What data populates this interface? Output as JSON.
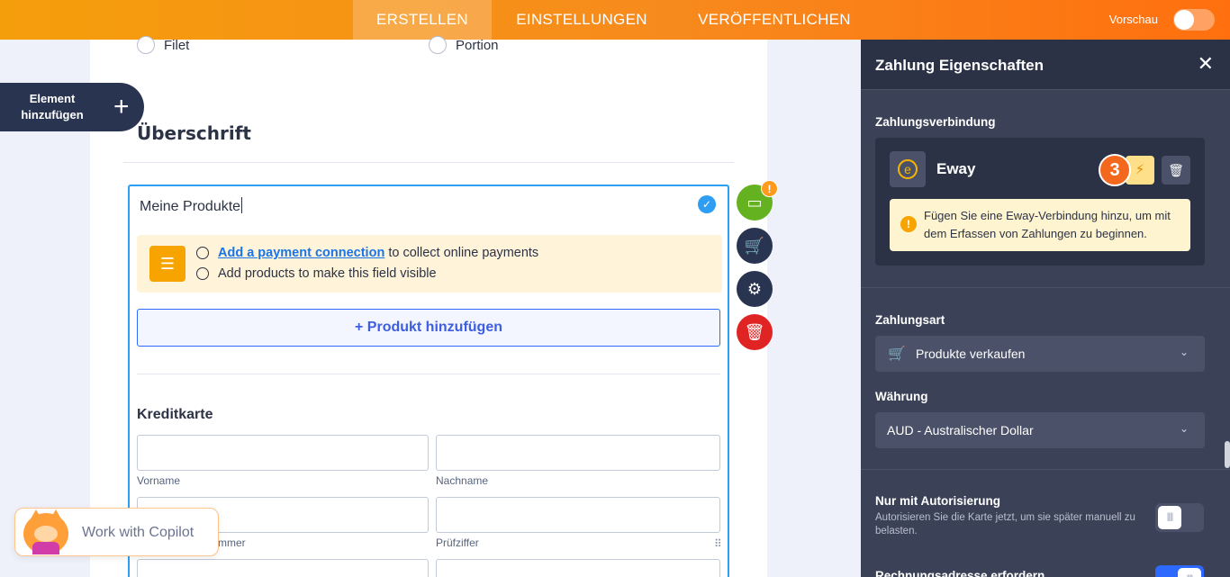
{
  "topbar": {
    "tabs": [
      {
        "label": "ERSTELLEN",
        "active": true
      },
      {
        "label": "EINSTELLUNGEN",
        "active": false
      },
      {
        "label": "VERÖFFENTLICHEN",
        "active": false
      }
    ],
    "preview_label": "Vorschau",
    "preview_on": false
  },
  "sidebar_button": {
    "label": "Element hinzufügen",
    "icon": "plus-icon"
  },
  "form": {
    "radio_options": [
      "Filet",
      "Portion"
    ],
    "heading": "Überschrift",
    "payment_field": {
      "title": "Meine Produkte",
      "notice": {
        "link": "Add a payment connection",
        "line1_rest": " to collect online payments",
        "line2": "Add products to make this field visible"
      },
      "add_product_label": "+ Produkt hinzufügen",
      "credit_card": {
        "heading": "Kreditkarte",
        "first_name": "Vorname",
        "last_name": "Nachname",
        "card_number_partial": "mmer",
        "check_digit": "Prüfziffer"
      }
    },
    "warning_badge": "!"
  },
  "copilot": {
    "label": "Work with Copilot"
  },
  "panel": {
    "title": "Zahlung Eigenschaften",
    "connection_heading": "Zahlungsverbindung",
    "gateway_name": "Eway",
    "step_number": "3",
    "tip_text": "Fügen Sie eine Eway-Verbindung hinzu, um mit dem Erfassen von Zahlungen zu beginnen.",
    "payment_type_label": "Zahlungsart",
    "payment_type_value": "Produkte verkaufen",
    "currency_label": "Währung",
    "currency_value": "AUD - Australischer Dollar",
    "auth_title": "Nur mit Autorisierung",
    "auth_desc": "Autorisieren Sie die Karte jetzt, um sie später manuell zu belasten.",
    "auth_on": false,
    "billing_title": "Rechnungsadresse erfordern",
    "billing_on": true
  },
  "colors": {
    "accent_orange": "#ff7a14",
    "panel_bg": "#3b4257",
    "field_blue": "#2e9ef2"
  }
}
